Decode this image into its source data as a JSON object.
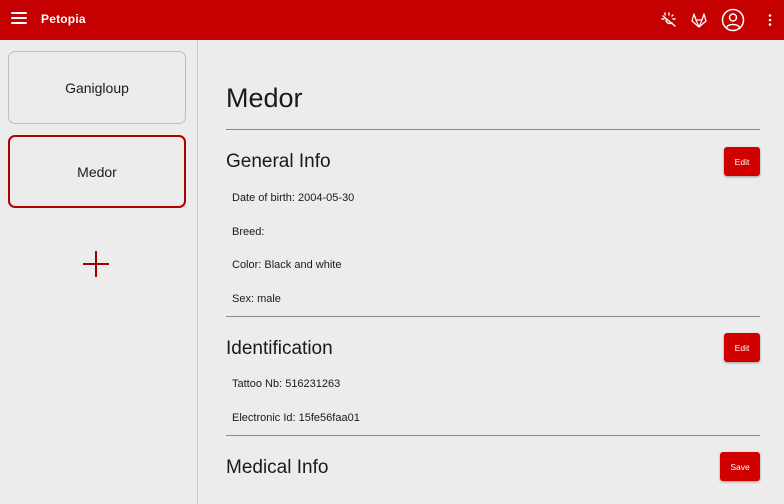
{
  "app": {
    "title": "Petopia"
  },
  "toolbar": {
    "icons": [
      "menu-icon",
      "theme-toggle-icon",
      "gitlab-icon",
      "account-icon",
      "more-vertical-icon"
    ],
    "accent_color": "#c40000"
  },
  "sidebar": {
    "pets": [
      {
        "name": "Ganigloup",
        "selected": false
      },
      {
        "name": "Medor",
        "selected": true
      }
    ],
    "add_icon": "plus-icon"
  },
  "pet": {
    "name": "Medor",
    "general": {
      "title": "General Info",
      "edit_label": "Edit",
      "fields": [
        "Date of birth: 2004-05-30",
        "Breed:",
        "Color: Black and white",
        "Sex: male"
      ]
    },
    "identification": {
      "title": "Identification",
      "edit_label": "Edit",
      "fields": [
        "Tattoo Nb: 516231263",
        "Electronic Id: 15fe56faa01"
      ]
    },
    "medical": {
      "title": "Medical Info",
      "save_label": "Save"
    }
  }
}
